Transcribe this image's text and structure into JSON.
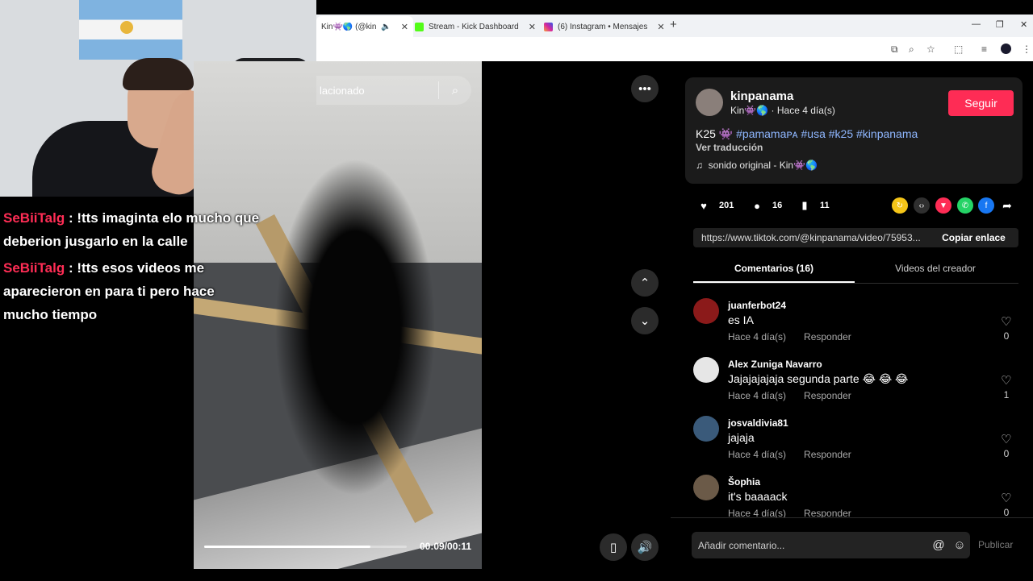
{
  "browser": {
    "tabs": [
      {
        "label": "Kin👾🌎 (@kinpanam",
        "active": true
      },
      {
        "label": "Stream - Kick Dashboard",
        "active": false
      },
      {
        "label": "(6) Instagram • Mensajes",
        "active": false
      }
    ],
    "new_tab": "+",
    "controls": {
      "minimize": "—",
      "restore": "❐",
      "close": "✕"
    }
  },
  "chat": {
    "messages": [
      {
        "user": "SeBiiTalg",
        "text": ": !tts imaginta elo mucho que deberion jusgarlo en la calle"
      },
      {
        "user": "SeBiiTalg",
        "text": ": !tts esos videos me aparecieron en para ti pero hace mucho tiempo"
      }
    ]
  },
  "video": {
    "search_text": "lacionado",
    "time": "00:09/00:11",
    "progress": 0.82
  },
  "post": {
    "username": "kinpanama",
    "subtitle": "Kin👾🌎 · Hace 4 día(s)",
    "follow_label": "Seguir",
    "caption_text": "K25 👾",
    "caption_tags": "#pamamaᴘᴀ #usa #k25 #kinpanama",
    "translate_label": "Ver traducción",
    "sound": "sonido original - Kin👾🌎",
    "likes": "201",
    "comments_count": "16",
    "saves": "11",
    "link": "https://www.tiktok.com/@kinpanama/video/75953...",
    "copy_label": "Copiar enlace"
  },
  "tabs": {
    "comments": "Comentarios (16)",
    "creator_videos": "Videos del creador"
  },
  "comments": [
    {
      "user": "juanferbot24",
      "text": "es IA",
      "time": "Hace 4 día(s)",
      "reply": "Responder",
      "likes": "0",
      "avatar_color": "#8b1a1a"
    },
    {
      "user": "Alex Zuniga Navarro",
      "text": "Jajajajajaja segunda parte 😂 😂 😂",
      "time": "Hace 4 día(s)",
      "reply": "Responder",
      "likes": "1",
      "avatar_color": "#e6e6e6"
    },
    {
      "user": "josvaldivia81",
      "text": "jajaja",
      "time": "Hace 4 día(s)",
      "reply": "Responder",
      "likes": "0",
      "avatar_color": "#3a5a7a"
    },
    {
      "user": "Šophia",
      "text": "it's baaaack",
      "time": "Hace 4 día(s)",
      "reply": "Responder",
      "likes": "0",
      "avatar_color": "#6b5a48"
    }
  ],
  "comment_input": {
    "placeholder": "Añadir comentario...",
    "publish_label": "Publicar"
  },
  "colors": {
    "accent": "#fe2c55",
    "tag": "#8fb7ff",
    "chat_user": "#ff2d55"
  }
}
